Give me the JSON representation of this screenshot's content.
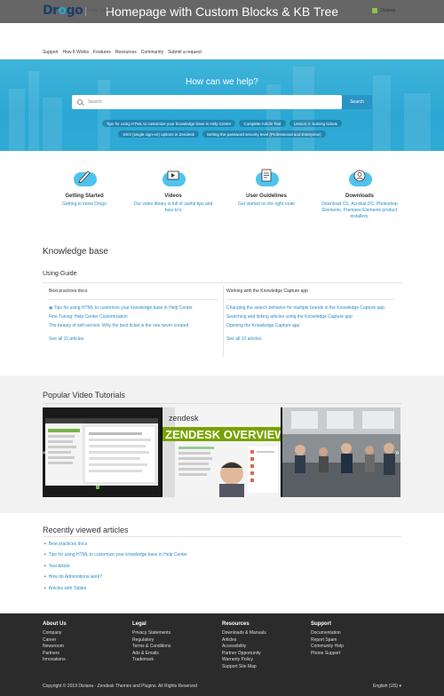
{
  "caption": "Homepage with Custom Blocks & KB Tree",
  "header": {
    "logo": {
      "part1": "Dr",
      "part2": "go",
      "accent": "o"
    },
    "help_center": "Help Center",
    "user": "Diziana"
  },
  "nav": [
    "Support",
    "How It Works",
    "Features",
    "Resources",
    "Community",
    "Submit a request"
  ],
  "hero": {
    "title": "How can we help?",
    "search_placeholder": "Search",
    "search_button": "Search",
    "chips_row1": [
      "Tips for using HTML to customize your knowledge base in Help Center",
      "Complete Article Test",
      "Lesson 3: Solving tickets"
    ],
    "chips_row2": [
      "SSO (single sign-on) options in Zendesk",
      "Setting the password security level (Professional and Enterprise)"
    ]
  },
  "blocks": [
    {
      "title": "Getting Started",
      "desc": "Getting to know Drogo",
      "icon": "pencil-icon"
    },
    {
      "title": "Videos",
      "desc": "Our video library is full of useful tips and how-to's",
      "icon": "monitor-icon"
    },
    {
      "title": "User Guidelines",
      "desc": "Get started on the right route",
      "icon": "document-icon"
    },
    {
      "title": "Downloads",
      "desc": "Download CS, Acrobat DC, Photoshop Elements, Premiere Elements product installers.",
      "icon": "person-icon"
    }
  ],
  "kb": {
    "title": "Knowledge base",
    "section": "Using Guide",
    "left": {
      "heading": "Best practices docs",
      "articles": [
        "Tips for using HTML to customize your knowledge base in Help Center",
        "Fine Tuning: Help Center Customization",
        "The beauty of self-service: Why the best ticket is the one never created"
      ],
      "more": "See all 11 articles"
    },
    "right": {
      "heading": "Working with the Knowledge Capture app",
      "articles": [
        "Changing the search behavior for multiple brands in the Knowledge Capture app",
        "Searching and linking articles using the Knowledge Capture app",
        "Opening the Knowledge Capture app"
      ],
      "more": "See all 10 articles"
    }
  },
  "videos": {
    "title": "Popular Video Tutorials",
    "thumb2_brand": "zendesk",
    "thumb2_title": "ZENDESK OVERVIEW"
  },
  "recent": {
    "title": "Recently viewed articles",
    "items": [
      "Best practices docs",
      "Tips for using HTML to customize your knowledge base in Help Center",
      "Test Article",
      "How do Admonitions work?",
      "Articles with Tables"
    ]
  },
  "footer": {
    "cols": [
      {
        "title": "About Us",
        "links": [
          "Company",
          "Career",
          "Newsroom",
          "Partners",
          "Innovations"
        ]
      },
      {
        "title": "Legal",
        "links": [
          "Privacy Statements",
          "Regulatory",
          "Terms & Conditions",
          "Ads & Emails",
          "Trademark"
        ]
      },
      {
        "title": "Resources",
        "links": [
          "Downloads & Manuals",
          "Articles",
          "Accessibility",
          "Partner Opportunity",
          "Warranty Policy",
          "Support Site Map"
        ]
      },
      {
        "title": "Support",
        "links": [
          "Documentation",
          "Report Spam",
          "Community Help",
          "Phone Support"
        ]
      }
    ],
    "copyright": "Copyright © 2019 Diziana - Zendesk Themes and Plugins. All Rights Reserved",
    "language": "English (US)"
  },
  "colors": {
    "accent": "#2a8dc5",
    "hero": "#2fa9d4",
    "footer": "#2b2b2b",
    "icon_cloud": "#4fc3ee"
  }
}
